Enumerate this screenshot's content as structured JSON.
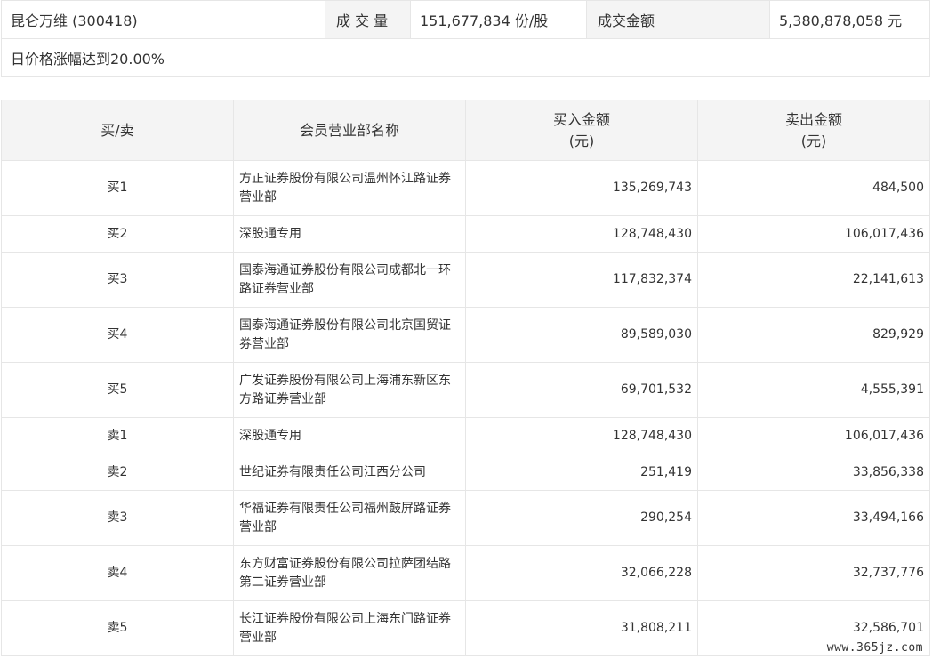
{
  "summary": {
    "stock_label": "昆仑万维 (300418)",
    "volume_label": "成 交 量",
    "volume_value": "151,677,834 份/股",
    "amount_label": "成交金额",
    "amount_value": "5,380,878,058 元",
    "reason": "日价格涨幅达到20.00%"
  },
  "table": {
    "headers": {
      "side": "买/卖",
      "name": "会员营业部名称",
      "buy_line1": "买入金额",
      "buy_line2": "(元)",
      "sell_line1": "卖出金额",
      "sell_line2": "(元)"
    },
    "rows": [
      {
        "side": "买1",
        "name": "方正证券股份有限公司温州怀江路证券营业部",
        "buy": "135,269,743",
        "sell": "484,500"
      },
      {
        "side": "买2",
        "name": "深股通专用",
        "buy": "128,748,430",
        "sell": "106,017,436"
      },
      {
        "side": "买3",
        "name": "国泰海通证券股份有限公司成都北一环路证券营业部",
        "buy": "117,832,374",
        "sell": "22,141,613"
      },
      {
        "side": "买4",
        "name": "国泰海通证券股份有限公司北京国贸证券营业部",
        "buy": "89,589,030",
        "sell": "829,929"
      },
      {
        "side": "买5",
        "name": "广发证券股份有限公司上海浦东新区东方路证券营业部",
        "buy": "69,701,532",
        "sell": "4,555,391"
      },
      {
        "side": "卖1",
        "name": "深股通专用",
        "buy": "128,748,430",
        "sell": "106,017,436"
      },
      {
        "side": "卖2",
        "name": "世纪证券有限责任公司江西分公司",
        "buy": "251,419",
        "sell": "33,856,338"
      },
      {
        "side": "卖3",
        "name": "华福证券有限责任公司福州鼓屏路证券营业部",
        "buy": "290,254",
        "sell": "33,494,166"
      },
      {
        "side": "卖4",
        "name": "东方财富证券股份有限公司拉萨团结路第二证券营业部",
        "buy": "32,066,228",
        "sell": "32,737,776"
      },
      {
        "side": "卖5",
        "name": "长江证券股份有限公司上海东门路证券营业部",
        "buy": "31,808,211",
        "sell": "32,586,701"
      }
    ]
  },
  "watermark": "www.365jz.com"
}
